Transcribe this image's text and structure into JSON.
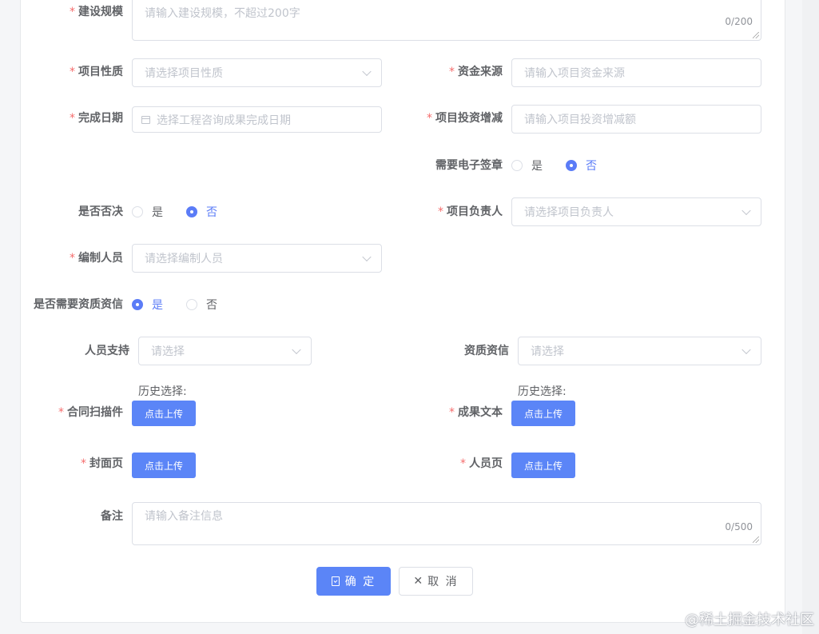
{
  "fields": {
    "scale": {
      "label": "建设规模",
      "placeholder": "请输入建设规模，不超过200字",
      "count": "0/200"
    },
    "nature": {
      "label": "项目性质",
      "placeholder": "请选择项目性质"
    },
    "funding": {
      "label": "资金来源",
      "placeholder": "请输入项目资金来源"
    },
    "finish_date": {
      "label": "完成日期",
      "placeholder": "选择工程咨询成果完成日期"
    },
    "investment_change": {
      "label": "项目投资增减",
      "placeholder": "请输入项目投资增减额"
    },
    "e_signature": {
      "label": "需要电子签章",
      "options": [
        "是",
        "否"
      ],
      "selected": "否"
    },
    "veto": {
      "label": "是否否决",
      "options": [
        "是",
        "否"
      ],
      "selected": "否"
    },
    "manager": {
      "label": "项目负责人",
      "placeholder": "请选择项目负责人"
    },
    "editor": {
      "label": "编制人员",
      "placeholder": "请选择编制人员"
    },
    "need_qualification": {
      "label": "是否需要资质资信",
      "options": [
        "是",
        "否"
      ],
      "selected": "是"
    },
    "staff_support": {
      "label": "人员支持",
      "placeholder": "请选择"
    },
    "qualification": {
      "label": "资质资信",
      "placeholder": "请选择"
    },
    "contract_scan": {
      "label": "合同扫描件",
      "history": "历史选择:",
      "button": "点击上传"
    },
    "result_text": {
      "label": "成果文本",
      "history": "历史选择:",
      "button": "点击上传"
    },
    "cover_page": {
      "label": "封面页",
      "button": "点击上传"
    },
    "staff_page": {
      "label": "人员页",
      "button": "点击上传"
    },
    "remarks": {
      "label": "备注",
      "placeholder": "请输入备注信息",
      "count": "0/500"
    }
  },
  "actions": {
    "confirm": "确 定",
    "cancel": "取 消"
  },
  "watermark": "@稀土掘金技术社区",
  "colors": {
    "primary": "#5b85f7",
    "required": "#f56c6c",
    "border": "#dcdfe6",
    "placeholder": "#c0c4cc"
  }
}
